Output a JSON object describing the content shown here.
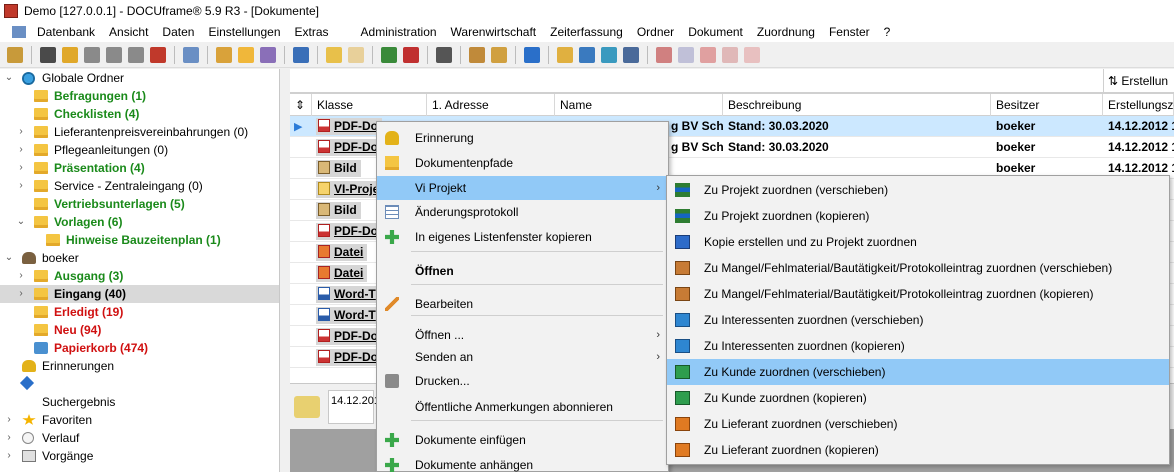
{
  "window": {
    "title": "Demo [127.0.0.1] - DOCUframe® 5.9 R3 - [Dokumente]"
  },
  "menubar": [
    "Datenbank",
    "Ansicht",
    "Daten",
    "Einstellungen",
    "Extras",
    "Administration",
    "Warenwirtschaft",
    "Zeiterfassung",
    "Ordner",
    "Dokument",
    "Zuordnung",
    "Fenster",
    "?"
  ],
  "tree": [
    {
      "label": "Globale Ordner",
      "level": 0,
      "style": "normal",
      "icon": "globe-icon",
      "chevron": "v"
    },
    {
      "label": "Befragungen (1)",
      "level": 1,
      "style": "green",
      "icon": "folder-icon"
    },
    {
      "label": "Checklisten (4)",
      "level": 1,
      "style": "green",
      "icon": "folder-icon"
    },
    {
      "label": "Lieferantenpreisvereinbahrungen (0)",
      "level": 1,
      "style": "normal",
      "icon": "folder-icon",
      "chevron": ">"
    },
    {
      "label": "Pflegeanleitungen (0)",
      "level": 1,
      "style": "normal",
      "icon": "folder-icon",
      "chevron": ">"
    },
    {
      "label": "Präsentation (4)",
      "level": 1,
      "style": "green",
      "icon": "folder-icon",
      "chevron": ">"
    },
    {
      "label": "Service - Zentraleingang (0)",
      "level": 1,
      "style": "normal",
      "icon": "folder-icon",
      "chevron": ">"
    },
    {
      "label": "Vertriebsunterlagen (5)",
      "level": 1,
      "style": "green",
      "icon": "folder-icon"
    },
    {
      "label": "Vorlagen (6)",
      "level": 1,
      "style": "green",
      "icon": "folder-icon",
      "chevron": "v"
    },
    {
      "label": "Hinweise Bauzeitenplan (1)",
      "level": 2,
      "style": "green",
      "icon": "folder-icon"
    },
    {
      "label": "boeker",
      "level": 0,
      "style": "normal",
      "icon": "user-icon",
      "chevron": "v"
    },
    {
      "label": "Ausgang (3)",
      "level": 1,
      "style": "green",
      "icon": "folder-icon",
      "chevron": ">"
    },
    {
      "label": "Eingang (40)",
      "level": 1,
      "style": "boldblack",
      "icon": "folder-icon",
      "chevron": ">",
      "selected": true
    },
    {
      "label": "Erledigt (19)",
      "level": 1,
      "style": "red",
      "icon": "folder-icon"
    },
    {
      "label": "Neu (94)",
      "level": 1,
      "style": "red",
      "icon": "folder-icon"
    },
    {
      "label": "Papierkorb (474)",
      "level": 1,
      "style": "red",
      "icon": "trash-icon"
    },
    {
      "label": "Erinnerungen",
      "level": 0,
      "style": "normal",
      "icon": "bell-icon"
    },
    {
      "label": "",
      "level": 0,
      "style": "normal",
      "icon": "pin-icon"
    },
    {
      "label": "Suchergebnis",
      "level": 0,
      "style": "normal",
      "icon": "search-result-icon"
    },
    {
      "label": "Favoriten",
      "level": 0,
      "style": "normal",
      "icon": "star-icon",
      "chevron": ">"
    },
    {
      "label": "Verlauf",
      "level": 0,
      "style": "normal",
      "icon": "history-icon",
      "chevron": ">"
    },
    {
      "label": "Vorgänge",
      "level": 0,
      "style": "normal",
      "icon": "process-icon",
      "chevron": ">"
    }
  ],
  "sort_button": {
    "label": "Erstellun"
  },
  "grid": {
    "columns": [
      "Klasse",
      "1. Adresse",
      "Name",
      "Beschreibung",
      "Besitzer",
      "Erstellungsze"
    ],
    "rows": [
      {
        "klasse": "PDF-Do",
        "icon": "pdf",
        "name": "g BV Scha",
        "beschreibung": "Stand: 30.03.2020",
        "besitzer": "boeker",
        "erstellt": "14.12.2012 1",
        "selected": true
      },
      {
        "klasse": "PDF-Do",
        "icon": "pdf",
        "name": "g BV Scha",
        "beschreibung": "Stand: 30.03.2020",
        "besitzer": "boeker",
        "erstellt": "14.12.2012 1"
      },
      {
        "klasse": "Bild",
        "icon": "img",
        "name": "",
        "beschreibung": "",
        "besitzer": "boeker",
        "erstellt": "14.12.2012 1"
      },
      {
        "klasse": "VI-Proje",
        "icon": "vi",
        "name": "",
        "beschreibung": "",
        "besitzer": "",
        "erstellt": ""
      },
      {
        "klasse": "Bild",
        "icon": "img",
        "name": "",
        "beschreibung": "",
        "besitzer": "",
        "erstellt": ""
      },
      {
        "klasse": "PDF-Do",
        "icon": "pdf",
        "name": "",
        "beschreibung": "",
        "besitzer": "",
        "erstellt": ""
      },
      {
        "klasse": "Datei",
        "icon": "datei",
        "name": "",
        "beschreibung": "",
        "besitzer": "",
        "erstellt": ""
      },
      {
        "klasse": "Datei",
        "icon": "datei",
        "name": "",
        "beschreibung": "",
        "besitzer": "",
        "erstellt": ""
      },
      {
        "klasse": "Word-T",
        "icon": "word",
        "name": "",
        "beschreibung": "",
        "besitzer": "",
        "erstellt": ""
      },
      {
        "klasse": "Word-T",
        "icon": "word",
        "name": "",
        "beschreibung": "",
        "besitzer": "",
        "erstellt": ""
      },
      {
        "klasse": "PDF-Do",
        "icon": "pdf",
        "name": "",
        "beschreibung": "",
        "besitzer": "",
        "erstellt": ""
      },
      {
        "klasse": "PDF-Do",
        "icon": "pdf",
        "name": "",
        "beschreibung": "",
        "besitzer": "",
        "erstellt": ""
      }
    ]
  },
  "preview": {
    "date": "14.12.201"
  },
  "context_menu": [
    {
      "label": "Erinnerung",
      "icon": "bell-icon"
    },
    {
      "label": "Dokumentenpfade",
      "icon": "folder-icon"
    },
    {
      "label": "Vi Projekt",
      "icon": "",
      "submenu": true,
      "highlighted": true
    },
    {
      "label": "Änderungsprotokoll",
      "icon": "grid-icon"
    },
    {
      "label": "In eigenes Listenfenster kopieren",
      "icon": "plus-icon"
    },
    {
      "label": "Öffnen",
      "icon": "",
      "bold": true
    },
    {
      "label": "Bearbeiten",
      "icon": "pen-icon"
    },
    {
      "label": "Öffnen ...",
      "icon": "",
      "submenu": true
    },
    {
      "label": "Senden an",
      "icon": "",
      "submenu": true
    },
    {
      "label": "Drucken...",
      "icon": "printer-icon"
    },
    {
      "label": "Öffentliche Anmerkungen abonnieren",
      "icon": ""
    },
    {
      "label": "Dokumente einfügen",
      "icon": "plus-icon"
    },
    {
      "label": "Dokumente anhängen",
      "icon": "plus-icon"
    }
  ],
  "submenu": [
    {
      "label": "Zu Projekt zuordnen (verschieben)",
      "icon": "project-icon"
    },
    {
      "label": "Zu Projekt zuordnen (kopieren)",
      "icon": "project-icon"
    },
    {
      "label": "Kopie erstellen und zu Projekt zuordnen",
      "icon": "copy-project-icon"
    },
    {
      "label": "Zu Mangel/Fehlmaterial/Bautätigkeit/Protokolleintrag zuordnen (verschieben)",
      "icon": "box-icon"
    },
    {
      "label": "Zu Mangel/Fehlmaterial/Bautätigkeit/Protokolleintrag zuordnen (kopieren)",
      "icon": "box-icon"
    },
    {
      "label": "Zu Interessenten zuordnen (verschieben)",
      "icon": "contact-card-icon"
    },
    {
      "label": "Zu Interessenten zuordnen (kopieren)",
      "icon": "contact-card-icon"
    },
    {
      "label": "Zu Kunde zuordnen (verschieben)",
      "icon": "customer-card-icon",
      "highlighted": true
    },
    {
      "label": "Zu Kunde zuordnen (kopieren)",
      "icon": "customer-card-icon"
    },
    {
      "label": "Zu Lieferant zuordnen (verschieben)",
      "icon": "supplier-card-icon"
    },
    {
      "label": "Zu Lieferant zuordnen (kopieren)",
      "icon": "supplier-card-icon"
    }
  ]
}
